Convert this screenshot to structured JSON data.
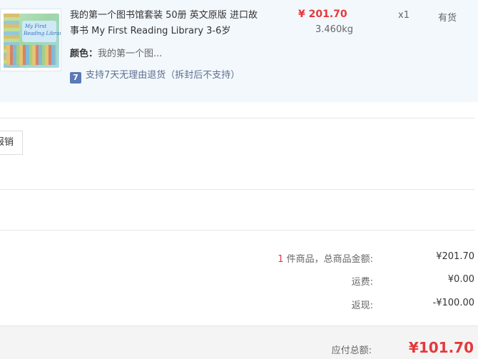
{
  "item": {
    "name": "我的第一个图书馆套装 50册 英文原版 进口故事书 My First Reading Library 3-6岁",
    "name_line1": "我的第一个图书馆套装 50册 英文原版 进口故",
    "name_line2": "事书 My First Reading Library 3-6岁",
    "price": "¥ 201.70",
    "weight": "3.460kg",
    "quantity": "x1",
    "stock": "有货",
    "color_label": "颜色：",
    "color_value": "我的第一个图...",
    "return_icon_text": "7",
    "return_policy": "支持7天无理由退货（拆封后不支持）",
    "thumb_title_1": "My First",
    "thumb_title_2": "Reading Library"
  },
  "invoice": {
    "button_label": "报销"
  },
  "summary": {
    "count": "1",
    "count_suffix": " 件商品，总商品金额:",
    "subtotal": "¥201.70",
    "shipping_label": "运费:",
    "shipping": "¥0.00",
    "rebate_label": "返现:",
    "rebate": "-¥100.00",
    "total_label": "应付总额:",
    "total": "¥101.70"
  },
  "colors": {
    "accent_red": "#e4393c",
    "item_bg": "#f3f8fd",
    "footer_bg": "#f4f4f4"
  },
  "icons": {
    "return_policy": "seven-day-return-icon"
  }
}
